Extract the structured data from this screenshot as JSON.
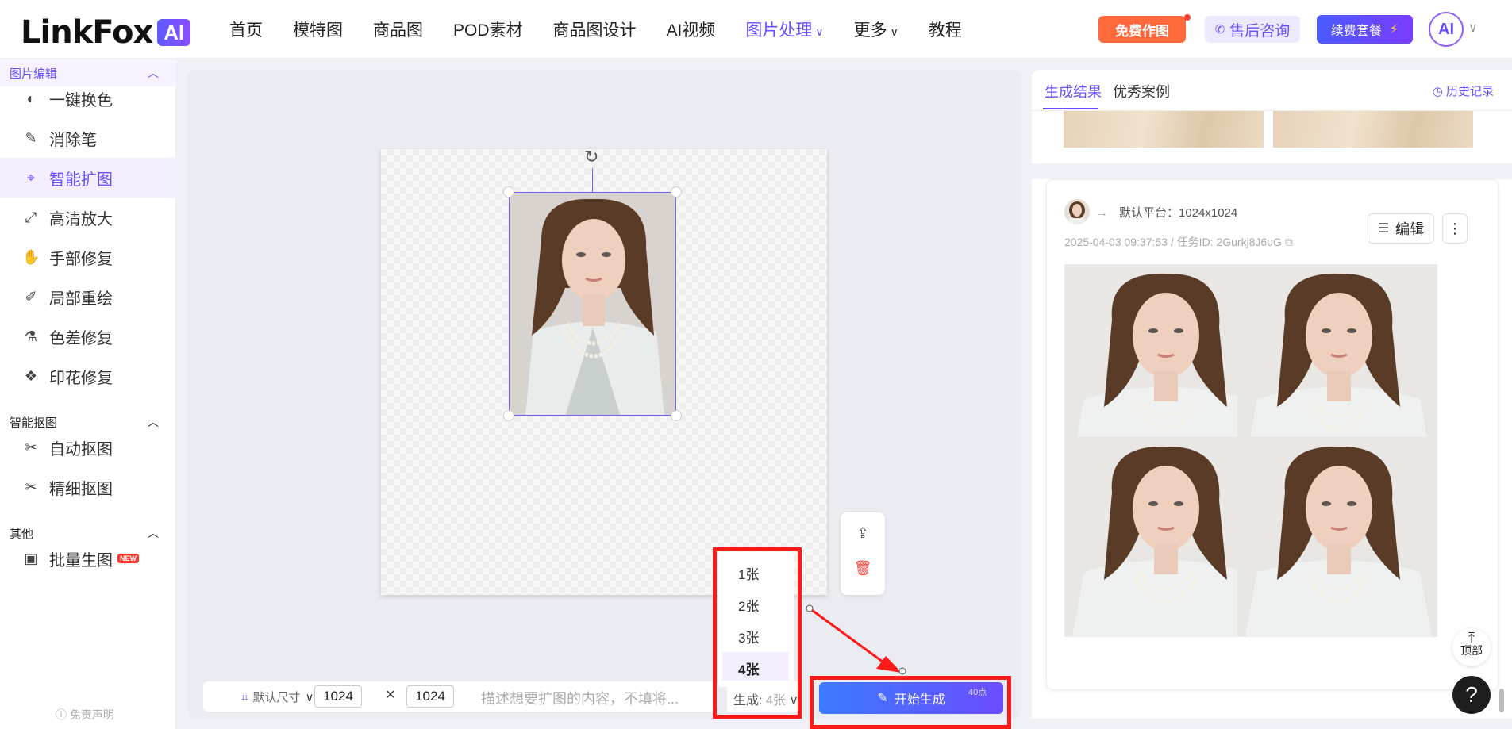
{
  "header": {
    "logo_text": "LinkFox",
    "logo_ai": "AI",
    "nav": [
      {
        "label": "首页",
        "active": false,
        "chevron": ""
      },
      {
        "label": "模特图",
        "active": false,
        "chevron": ""
      },
      {
        "label": "商品图",
        "active": false,
        "chevron": ""
      },
      {
        "label": "POD素材",
        "active": false,
        "chevron": ""
      },
      {
        "label": "商品图设计",
        "active": false,
        "chevron": ""
      },
      {
        "label": "AI视频",
        "active": false,
        "chevron": ""
      },
      {
        "label": "图片处理",
        "active": true,
        "chevron": "∨"
      },
      {
        "label": "更多",
        "active": false,
        "chevron": "∨"
      },
      {
        "label": "教程",
        "active": false,
        "chevron": ""
      }
    ],
    "free_btn": "免费作图",
    "consult_btn": "售后咨询",
    "renew_btn": "续费套餐",
    "avatar_text": "AI"
  },
  "sidebar": {
    "sections": [
      {
        "title": "图片编辑",
        "items": [
          "一键换色",
          "消除笔",
          "智能扩图",
          "高清放大",
          "手部修复",
          "局部重绘",
          "色差修复",
          "印花修复"
        ]
      },
      {
        "title": "智能抠图",
        "items": [
          "自动抠图",
          "精细抠图"
        ]
      },
      {
        "title": "其他",
        "items": [
          "批量生图"
        ]
      }
    ],
    "active_item": "智能扩图",
    "new_badge": "NEW",
    "disclaimer": "免责声明"
  },
  "canvas": {
    "size_label": "默认尺寸",
    "width": "1024",
    "height": "1024",
    "times": "×",
    "prompt_placeholder": "描述想要扩图的内容，不填将...",
    "gen_label": "生成:",
    "gen_value": "4张",
    "dropdown": [
      "1张",
      "2张",
      "3张",
      "4张"
    ],
    "dropdown_selected": "4张",
    "start_btn": "开始生成",
    "points": "40点"
  },
  "right": {
    "tabs": [
      "生成结果",
      "优秀案例"
    ],
    "history": "历史记录",
    "platform": "默认平台：1024x1024",
    "meta": "2025-04-03 09:37:53 / 任务ID: 2Gurkj8J6uG",
    "edit_btn": "编辑",
    "top_btn": "顶部",
    "help": "?"
  },
  "colors": {
    "accent": "#6b4dff",
    "highlight_red": "#ff1a1a",
    "free_orange": "#ff6a3d"
  }
}
